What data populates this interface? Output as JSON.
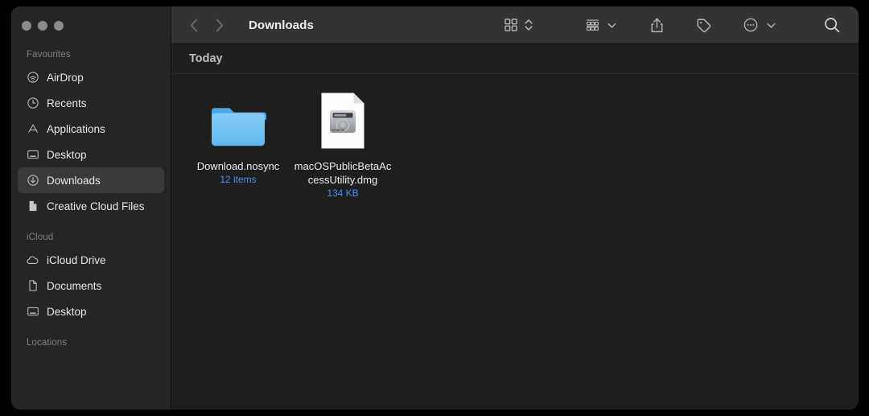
{
  "window": {
    "title": "Downloads",
    "traffic_lights": [
      {
        "name": "close",
        "color": "#8b8b8b"
      },
      {
        "name": "minimize",
        "color": "#8b8b8b"
      },
      {
        "name": "maximize",
        "color": "#8b8b8b"
      }
    ]
  },
  "toolbar": {
    "back_icon": "chevron-left-icon",
    "forward_icon": "chevron-right-icon",
    "view_icon": "grid-view-icon",
    "view_sort_icon": "chevron-up-down-icon",
    "group_icon": "group-by-icon",
    "group_chevron": "chevron-down-icon",
    "share_icon": "share-icon",
    "tag_icon": "tag-icon",
    "more_icon": "ellipsis-circle-icon",
    "more_chevron": "chevron-down-icon",
    "search_icon": "search-icon"
  },
  "sidebar": {
    "sections": [
      {
        "title": "Favourites",
        "items": [
          {
            "label": "AirDrop",
            "icon": "airdrop-icon",
            "selected": false
          },
          {
            "label": "Recents",
            "icon": "clock-icon",
            "selected": false
          },
          {
            "label": "Applications",
            "icon": "applications-icon",
            "selected": false
          },
          {
            "label": "Desktop",
            "icon": "desktop-icon",
            "selected": false
          },
          {
            "label": "Downloads",
            "icon": "downloads-icon",
            "selected": true
          },
          {
            "label": "Creative Cloud Files",
            "icon": "document-icon",
            "selected": false
          }
        ]
      },
      {
        "title": "iCloud",
        "items": [
          {
            "label": "iCloud Drive",
            "icon": "cloud-icon",
            "selected": false
          },
          {
            "label": "Documents",
            "icon": "document-outline-icon",
            "selected": false
          },
          {
            "label": "Desktop",
            "icon": "desktop-icon",
            "selected": false
          }
        ]
      },
      {
        "title": "Locations",
        "items": []
      }
    ]
  },
  "main": {
    "group_header": "Today",
    "files": [
      {
        "name": "Download.nosync",
        "meta": "12 items",
        "icon": "folder-icon"
      },
      {
        "name": "macOSPublicBetaAccessUtility.dmg",
        "meta": "134 KB",
        "icon": "dmg-disk-image-icon"
      }
    ]
  },
  "colors": {
    "accent_blue": "#4f8ef7",
    "folder_blue": "#6fc1f4",
    "sidebar_bg": "#252525",
    "content_bg": "#1e1e1e",
    "toolbar_bg": "#333333",
    "selection_bg": "#3a3a3a"
  }
}
